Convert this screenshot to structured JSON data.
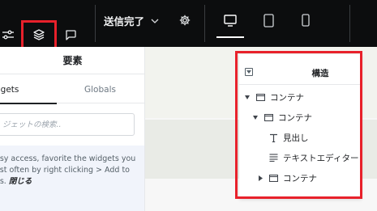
{
  "toolbar": {
    "publish_label": "送信完了",
    "icons": [
      "sliders-icon",
      "layers-icon",
      "comment-icon",
      "chevron-down-icon",
      "gear-icon",
      "desktop-icon",
      "tablet-icon",
      "mobile-icon"
    ]
  },
  "panel": {
    "title": "要素",
    "tabs": [
      {
        "label": "dgets"
      },
      {
        "label": "Globals"
      }
    ],
    "search_placeholder": "ジェットの検索..",
    "tip_lines": [
      "asy access, favorite the widgets you",
      "ost often by right clicking > Add to",
      "es. "
    ],
    "tip_link": "閉じる"
  },
  "navigator": {
    "title": "構造",
    "items": [
      {
        "label": "コンテナ",
        "icon": "container-icon",
        "caret": "expanded"
      },
      {
        "label": "コンテナ",
        "icon": "container-icon",
        "caret": "expanded"
      },
      {
        "label": "見出し",
        "icon": "heading-icon",
        "caret": "none"
      },
      {
        "label": "テキストエディター",
        "icon": "text-editor-icon",
        "caret": "none"
      },
      {
        "label": "コンテナ",
        "icon": "container-icon",
        "caret": "collapsed"
      }
    ]
  },
  "colors": {
    "topbar_bg": "#0c0d0e",
    "highlight": "#e8212b",
    "tip_bg": "#f1f4fb",
    "text_primary": "#1f2124"
  }
}
